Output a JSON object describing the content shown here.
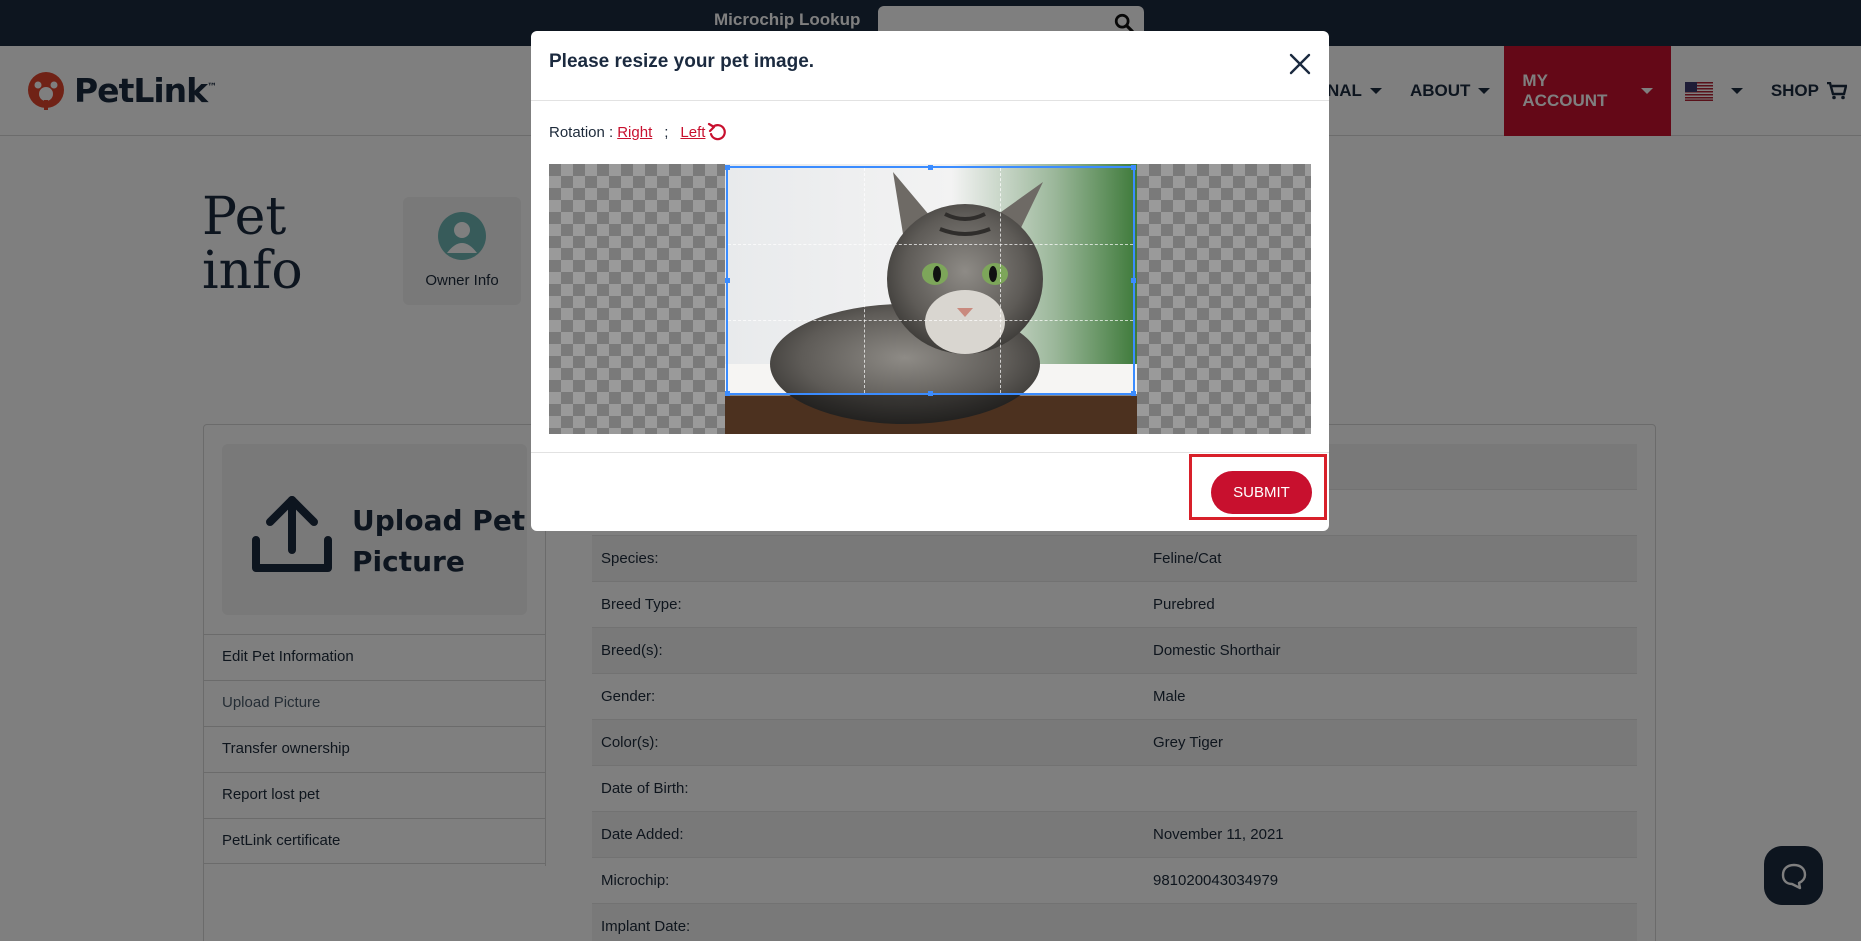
{
  "topbar": {
    "lookup_label": "Microchip Lookup",
    "lookup_placeholder": ""
  },
  "brand": {
    "name": "PetLink",
    "tm": "™"
  },
  "nav": {
    "items": [
      {
        "label": "NAL"
      },
      {
        "label": "ABOUT"
      },
      {
        "label": "MY ACCOUNT"
      },
      {
        "label": "SHOP"
      }
    ],
    "accent_color": "#c8102e"
  },
  "page": {
    "title_line1": "Pet",
    "title_line2": "info",
    "owner_label": "Owner Info"
  },
  "sidebar": {
    "upload_line1": "Upload Pet",
    "upload_line2": "Picture",
    "items": [
      {
        "label": "Edit Pet Information"
      },
      {
        "label": "Upload Picture"
      },
      {
        "label": "Transfer ownership"
      },
      {
        "label": "Report lost pet"
      },
      {
        "label": "PetLink certificate"
      }
    ]
  },
  "details": {
    "rows": [
      {
        "key": "",
        "value": ""
      },
      {
        "key": "",
        "value": ""
      },
      {
        "key": "Species:",
        "value": "Feline/Cat"
      },
      {
        "key": "Breed Type:",
        "value": "Purebred"
      },
      {
        "key": "Breed(s):",
        "value": "Domestic Shorthair"
      },
      {
        "key": "Gender:",
        "value": "Male"
      },
      {
        "key": "Color(s):",
        "value": "Grey Tiger"
      },
      {
        "key": "Date of Birth:",
        "value": ""
      },
      {
        "key": "Date Added:",
        "value": "November 11, 2021"
      },
      {
        "key": "Microchip:",
        "value": "981020043034979"
      },
      {
        "key": "Implant Date:",
        "value": ""
      }
    ]
  },
  "modal": {
    "title": "Please resize your pet image.",
    "rotation_label": "Rotation :",
    "rotate_right": "Right",
    "separator": ";",
    "rotate_left": "Left",
    "submit": "SUBMIT"
  },
  "icons": {
    "search": "search-icon",
    "close": "close-icon",
    "rotate": "rotate-left-icon",
    "cart": "cart-icon",
    "chat": "chat-icon",
    "upload": "upload-icon"
  }
}
